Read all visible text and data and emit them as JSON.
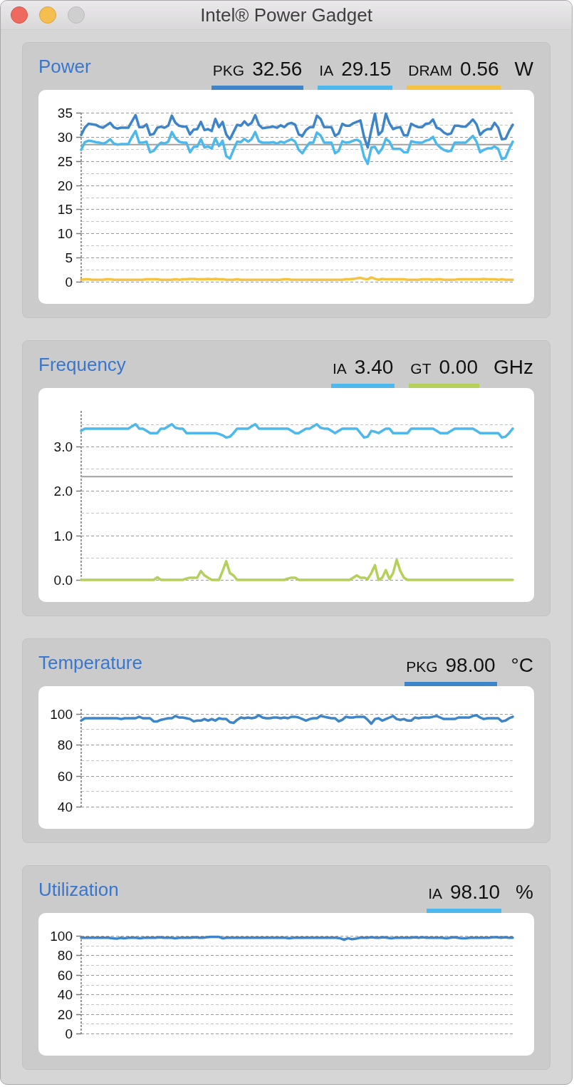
{
  "window": {
    "title": "Intel® Power Gadget",
    "controls": [
      {
        "kind": "close",
        "disabled": false
      },
      {
        "kind": "minimize",
        "disabled": false
      },
      {
        "kind": "zoom",
        "disabled": true
      }
    ]
  },
  "panels": [
    {
      "title": "Power",
      "legend": [
        {
          "label": "PKG",
          "value": "32.56",
          "color": "#3d85c8"
        },
        {
          "label": "IA",
          "value": "29.15",
          "color": "#4db8ec"
        },
        {
          "label": "DRAM",
          "value": "0.56",
          "color": "#f5c242"
        }
      ],
      "unit": "W",
      "chart_data": {
        "type": "line",
        "grid": true,
        "ylim": [
          0,
          35
        ],
        "yticks": [
          0,
          5,
          10,
          15,
          20,
          25,
          30,
          35
        ],
        "ref_lines": [
          {
            "axis": "y",
            "value": 28.4
          }
        ],
        "series": [
          {
            "color": "#3d85c8",
            "values": [
              30.4,
              31.9,
              32.7,
              32.6,
              32.5,
              32.1,
              31.9,
              32.4,
              32.9,
              32.0,
              31.7,
              31.9,
              31.9,
              31.9,
              33.2,
              34.5,
              32.0,
              32.0,
              32.6,
              30.4,
              30.6,
              31.9,
              32.1,
              31.9,
              32.3,
              34.4,
              32.9,
              32.3,
              32.1,
              32.1,
              30.5,
              31.5,
              31.6,
              33.1,
              31.4,
              31.6,
              31.2,
              33.7,
              32.0,
              33.1,
              30.5,
              29.5,
              31.0,
              32.5,
              32.3,
              33.2,
              32.4,
              32.9,
              34.5,
              32.5,
              31.8,
              31.9,
              32.0,
              32.1,
              31.9,
              32.4,
              32.0,
              32.7,
              32.9,
              32.5,
              30.5,
              30.2,
              31.4,
              32.0,
              32.0,
              34.4,
              33.7,
              32.0,
              32.0,
              32.0,
              30.2,
              30.7,
              32.7,
              32.3,
              32.3,
              32.8,
              33.1,
              33.4,
              30.0,
              27.8,
              31.4,
              34.8,
              30.4,
              31.2,
              34.8,
              32.8,
              31.6,
              31.9,
              32.0,
              30.3,
              30.3,
              32.7,
              32.3,
              32.0,
              32.0,
              32.7,
              32.8,
              33.6,
              31.9,
              31.6,
              30.9,
              30.5,
              30.7,
              32.3,
              32.3,
              32.1,
              32.1,
              32.8,
              33.6,
              32.6,
              30.4,
              31.2,
              31.6,
              31.6,
              32.9,
              31.9,
              29.5,
              29.6,
              31.2,
              32.5
            ]
          },
          {
            "color": "#4db8ec",
            "values": [
              27.3,
              28.9,
              29.2,
              29.1,
              28.9,
              28.8,
              28.6,
              28.9,
              29.5,
              28.6,
              28.4,
              28.5,
              28.5,
              28.5,
              30.0,
              31.2,
              28.8,
              28.8,
              29.0,
              26.8,
              27.1,
              28.1,
              28.8,
              28.6,
              29.0,
              31.0,
              29.7,
              29.0,
              28.8,
              28.8,
              26.8,
              27.9,
              28.0,
              29.5,
              27.8,
              28.0,
              27.6,
              29.7,
              28.1,
              29.2,
              26.0,
              25.5,
              27.3,
              29.0,
              28.9,
              29.6,
              29.0,
              29.5,
              31.0,
              29.1,
              28.8,
              28.8,
              28.8,
              28.9,
              28.6,
              29.0,
              28.8,
              29.2,
              29.5,
              29.0,
              27.3,
              26.6,
              27.8,
              28.8,
              28.8,
              30.9,
              30.3,
              28.8,
              28.8,
              28.8,
              26.6,
              27.1,
              29.1,
              28.8,
              28.9,
              29.2,
              29.4,
              29.0,
              25.9,
              24.4,
              27.8,
              27.9,
              26.6,
              27.6,
              29.6,
              29.0,
              27.5,
              27.5,
              27.5,
              26.8,
              26.8,
              29.1,
              28.9,
              28.8,
              28.8,
              29.2,
              29.4,
              30.0,
              28.5,
              27.8,
              27.3,
              27.0,
              27.1,
              28.8,
              28.8,
              28.8,
              28.8,
              29.5,
              30.2,
              29.0,
              26.8,
              27.3,
              27.6,
              27.6,
              28.0,
              27.5,
              25.4,
              25.7,
              27.5,
              29.0
            ]
          },
          {
            "color": "#f5c242",
            "values": [
              0.4,
              0.5,
              0.5,
              0.4,
              0.4,
              0.4,
              0.4,
              0.5,
              0.5,
              0.4,
              0.4,
              0.4,
              0.4,
              0.4,
              0.4,
              0.4,
              0.4,
              0.4,
              0.5,
              0.5,
              0.5,
              0.5,
              0.4,
              0.4,
              0.4,
              0.4,
              0.5,
              0.4,
              0.5,
              0.5,
              0.6,
              0.6,
              0.5,
              0.5,
              0.5,
              0.6,
              0.5,
              0.6,
              0.5,
              0.5,
              0.4,
              0.4,
              0.4,
              0.5,
              0.4,
              0.4,
              0.4,
              0.4,
              0.4,
              0.4,
              0.4,
              0.4,
              0.4,
              0.4,
              0.4,
              0.4,
              0.5,
              0.5,
              0.4,
              0.4,
              0.4,
              0.4,
              0.4,
              0.4,
              0.4,
              0.4,
              0.4,
              0.4,
              0.4,
              0.4,
              0.4,
              0.4,
              0.4,
              0.5,
              0.5,
              0.6,
              0.7,
              0.8,
              0.6,
              0.5,
              0.9,
              0.6,
              0.4,
              0.6,
              0.5,
              0.5,
              0.5,
              0.5,
              0.5,
              0.5,
              0.4,
              0.4,
              0.4,
              0.4,
              0.5,
              0.5,
              0.5,
              0.4,
              0.5,
              0.5,
              0.4,
              0.4,
              0.4,
              0.4,
              0.5,
              0.5,
              0.5,
              0.5,
              0.5,
              0.5,
              0.5,
              0.6,
              0.5,
              0.5,
              0.5,
              0.4,
              0.5,
              0.4,
              0.4,
              0.4
            ]
          }
        ]
      }
    },
    {
      "title": "Frequency",
      "legend": [
        {
          "label": "IA",
          "value": "3.40",
          "color": "#4db8ec"
        },
        {
          "label": "GT",
          "value": "0.00",
          "color": "#b5d05a"
        }
      ],
      "unit": "GHz",
      "chart_data": {
        "type": "line",
        "grid": true,
        "ylim": [
          0,
          3.8
        ],
        "yticks": [
          {
            "value": 0,
            "label": "0.0"
          },
          {
            "value": 1,
            "label": "1.0"
          },
          {
            "value": 2,
            "label": "2.0"
          },
          {
            "value": 3,
            "label": "3.0"
          }
        ],
        "ref_lines": [
          {
            "axis": "y",
            "value": 2.32
          }
        ],
        "series": [
          {
            "color": "#4db8ec",
            "values": [
              3.35,
              3.4,
              3.4,
              3.4,
              3.4,
              3.4,
              3.4,
              3.4,
              3.4,
              3.4,
              3.4,
              3.4,
              3.4,
              3.4,
              3.45,
              3.5,
              3.4,
              3.4,
              3.35,
              3.3,
              3.3,
              3.3,
              3.4,
              3.4,
              3.45,
              3.5,
              3.42,
              3.4,
              3.4,
              3.3,
              3.3,
              3.3,
              3.3,
              3.3,
              3.3,
              3.3,
              3.3,
              3.3,
              3.28,
              3.25,
              3.2,
              3.22,
              3.3,
              3.4,
              3.4,
              3.4,
              3.4,
              3.45,
              3.5,
              3.4,
              3.4,
              3.4,
              3.4,
              3.4,
              3.4,
              3.4,
              3.4,
              3.4,
              3.35,
              3.3,
              3.3,
              3.35,
              3.4,
              3.4,
              3.45,
              3.5,
              3.42,
              3.4,
              3.4,
              3.35,
              3.3,
              3.35,
              3.4,
              3.4,
              3.4,
              3.4,
              3.4,
              3.3,
              3.2,
              3.22,
              3.35,
              3.33,
              3.3,
              3.35,
              3.4,
              3.4,
              3.3,
              3.3,
              3.3,
              3.3,
              3.3,
              3.4,
              3.4,
              3.4,
              3.4,
              3.4,
              3.4,
              3.4,
              3.35,
              3.3,
              3.3,
              3.3,
              3.35,
              3.4,
              3.4,
              3.4,
              3.4,
              3.4,
              3.4,
              3.35,
              3.3,
              3.3,
              3.3,
              3.3,
              3.3,
              3.3,
              3.2,
              3.22,
              3.3,
              3.4
            ]
          },
          {
            "color": "#b5d05a",
            "values": [
              0,
              0,
              0,
              0,
              0,
              0,
              0,
              0,
              0,
              0,
              0,
              0,
              0,
              0,
              0,
              0,
              0,
              0,
              0,
              0,
              0,
              0.06,
              0,
              0,
              0,
              0,
              0,
              0,
              0,
              0.03,
              0.05,
              0.05,
              0.05,
              0.2,
              0.1,
              0.05,
              0,
              0,
              0,
              0.2,
              0.42,
              0.15,
              0.1,
              0,
              0,
              0,
              0,
              0,
              0,
              0,
              0,
              0,
              0,
              0,
              0,
              0,
              0,
              0.03,
              0.05,
              0.05,
              0,
              0,
              0,
              0,
              0,
              0,
              0,
              0,
              0,
              0,
              0,
              0,
              0,
              0,
              0,
              0.05,
              0.1,
              0.05,
              0.05,
              0.02,
              0.15,
              0.33,
              0,
              0.05,
              0.22,
              0.02,
              0.15,
              0.45,
              0.2,
              0.05,
              0,
              0,
              0,
              0,
              0,
              0,
              0,
              0,
              0,
              0,
              0,
              0,
              0,
              0,
              0,
              0,
              0,
              0,
              0,
              0,
              0,
              0,
              0,
              0,
              0,
              0,
              0,
              0,
              0,
              0
            ]
          }
        ]
      }
    },
    {
      "title": "Temperature",
      "legend": [
        {
          "label": "PKG",
          "value": "98.00",
          "color": "#3d85c8"
        }
      ],
      "unit": "°C",
      "chart_data": {
        "type": "line",
        "grid": true,
        "ylim": [
          40,
          103
        ],
        "yticks": [
          40,
          60,
          80,
          100
        ],
        "series": [
          {
            "color": "#3d85c8",
            "values": [
              95.5,
              97,
              97,
              97,
              97,
              97,
              97,
              97,
              97,
              97,
              97,
              96.5,
              97,
              97,
              97,
              97,
              98,
              97,
              97,
              97,
              95,
              95,
              96,
              96.5,
              97,
              97,
              98.5,
              97.5,
              97.5,
              97,
              96.5,
              95,
              95.5,
              95.5,
              96.5,
              95.5,
              96.5,
              95.5,
              97,
              96.5,
              96.5,
              94.5,
              94,
              96,
              97.5,
              97,
              97.5,
              97,
              97.5,
              99,
              97.5,
              97,
              97,
              97.5,
              97.5,
              97,
              97.5,
              97,
              98,
              98,
              97.5,
              96.5,
              95.5,
              96.5,
              97,
              97,
              98.5,
              98,
              97.5,
              97,
              97,
              95,
              96,
              98,
              97.5,
              97.5,
              98,
              98,
              98,
              96,
              93.5,
              96.5,
              97,
              95.5,
              96.5,
              97.5,
              98.5,
              96.5,
              96,
              96.5,
              95.5,
              95.5,
              97.5,
              97,
              97.5,
              97.5,
              97.5,
              98,
              98.5,
              97.5,
              96.5,
              96.5,
              96.5,
              96.5,
              97.5,
              97.5,
              97.5,
              97.5,
              98.5,
              99,
              97.5,
              96.5,
              97,
              97,
              97,
              97,
              95,
              95.5,
              97,
              98
            ]
          }
        ]
      }
    },
    {
      "title": "Utilization",
      "legend": [
        {
          "label": "IA",
          "value": "98.10",
          "color": "#4db8ec"
        }
      ],
      "unit": "%",
      "chart_data": {
        "type": "line",
        "grid": true,
        "ylim": [
          0,
          100
        ],
        "yticks": [
          0,
          20,
          40,
          60,
          80,
          100
        ],
        "series": [
          {
            "color": "#3d85c8",
            "values": [
              98,
              98,
              98,
              98,
              98,
              98,
              98,
              98,
              97.5,
              97,
              98,
              97.5,
              98,
              98,
              98,
              97.5,
              98,
              98,
              98,
              98,
              98.5,
              98,
              98,
              98,
              97.5,
              98,
              98,
              98,
              98,
              98.5,
              98,
              98,
              98.5,
              99,
              99,
              99,
              97.5,
              98,
              98,
              98,
              98,
              98,
              98,
              98,
              98,
              98,
              98,
              98,
              98,
              98,
              98,
              98,
              98,
              97.5,
              98,
              98,
              98,
              98,
              98,
              98,
              98,
              98,
              98,
              98,
              98,
              98,
              97.5,
              96,
              97.5,
              96.5,
              97,
              98,
              98,
              98,
              98.5,
              98,
              98,
              98.5,
              98,
              97.5,
              98,
              98,
              98,
              98,
              98,
              98.5,
              98,
              98.5,
              98,
              98,
              98,
              98,
              98,
              97.5,
              98,
              98.5,
              98,
              97.5,
              97.5,
              98,
              98,
              98,
              98,
              98,
              98,
              98.5,
              98.5,
              98,
              98.5,
              98,
              98
            ]
          }
        ]
      }
    }
  ]
}
